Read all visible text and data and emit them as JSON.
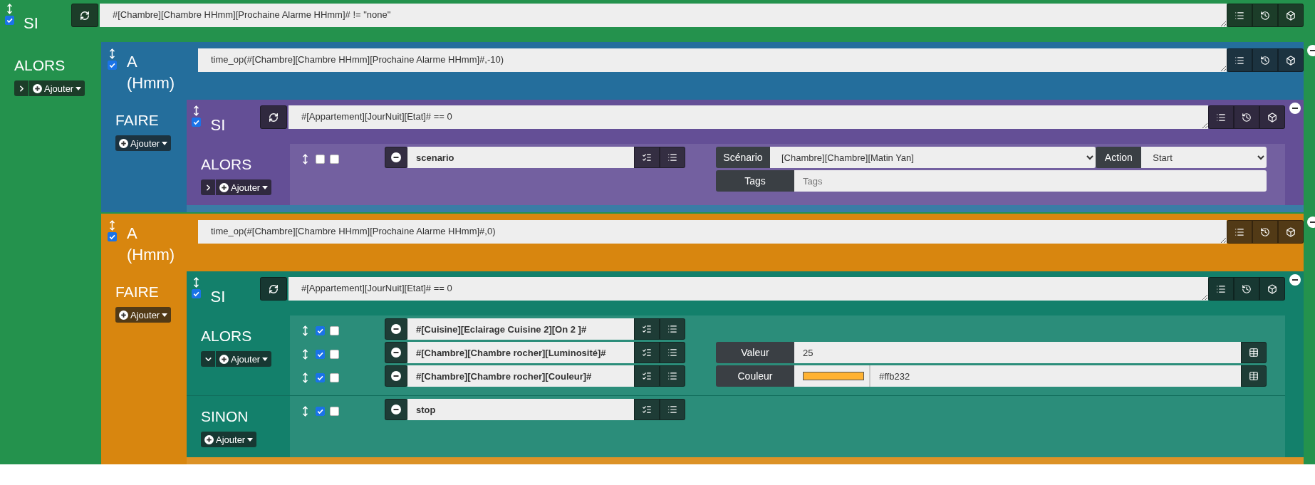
{
  "root": {
    "kind": "si",
    "color": "#24924d",
    "enabled": true,
    "label": "SI",
    "expression": "#[Chambre][Chambre HHmm][Prochaine Alarme HHmm]# != \"none\"",
    "sections": [
      {
        "label": "ALORS",
        "expanded": false,
        "add_label": "Ajouter",
        "blocks": [
          {
            "kind": "a",
            "color": "#246e9c",
            "enabled": true,
            "label": "A (Hmm)",
            "expression": "time_op(#[Chambre][Chambre HHmm][Prochaine Alarme HHmm]#,-10)",
            "sections": [
              {
                "label": "FAIRE",
                "add_label": "Ajouter",
                "blocks": [
                  {
                    "kind": "si",
                    "color": "#644f96",
                    "enabled": true,
                    "label": "SI",
                    "expression": "#[Appartement][JourNuit][Etat]# == 0",
                    "sections": [
                      {
                        "label": "ALORS",
                        "expanded": false,
                        "add_label": "Ajouter",
                        "actions": [
                          {
                            "enabled": false,
                            "parallel": false,
                            "command": "scenario",
                            "option_rows": [
                              [
                                {
                                  "kind": "select",
                                  "label": "Scénario",
                                  "value": "[Chambre][Chambre][Matin Yan]"
                                },
                                {
                                  "kind": "select",
                                  "label": "Action",
                                  "value": "Start"
                                }
                              ],
                              [
                                {
                                  "kind": "text",
                                  "label": "Tags",
                                  "placeholder": "Tags"
                                }
                              ]
                            ]
                          }
                        ]
                      }
                    ]
                  }
                ]
              }
            ]
          },
          {
            "kind": "a",
            "color": "#d8860f",
            "enabled": true,
            "label": "A (Hmm)",
            "expression": "time_op(#[Chambre][Chambre HHmm][Prochaine Alarme HHmm]#,0)",
            "sections": [
              {
                "label": "FAIRE",
                "add_label": "Ajouter",
                "blocks": [
                  {
                    "kind": "si",
                    "color": "#13806b",
                    "enabled": true,
                    "label": "SI",
                    "expression": "#[Appartement][JourNuit][Etat]# == 0",
                    "sections": [
                      {
                        "label": "ALORS",
                        "expanded": true,
                        "add_label": "Ajouter",
                        "actions": [
                          {
                            "enabled": true,
                            "parallel": false,
                            "command": "#[Cuisine][Eclairage Cuisine 2][On 2 ]#"
                          },
                          {
                            "enabled": true,
                            "parallel": false,
                            "command": "#[Chambre][Chambre rocher][Luminosité]#",
                            "option_rows": [
                              [
                                {
                                  "kind": "value",
                                  "label": "Valeur",
                                  "value": "25"
                                }
                              ]
                            ]
                          },
                          {
                            "enabled": true,
                            "parallel": false,
                            "command": "#[Chambre][Chambre rocher][Couleur]#",
                            "option_rows": [
                              [
                                {
                                  "kind": "color",
                                  "label": "Couleur",
                                  "color": "#ffb232",
                                  "value": "#ffb232"
                                }
                              ]
                            ]
                          }
                        ]
                      },
                      {
                        "label": "SINON",
                        "add_label": "Ajouter",
                        "actions": [
                          {
                            "enabled": true,
                            "parallel": false,
                            "command": "stop"
                          }
                        ]
                      }
                    ]
                  }
                ]
              }
            ]
          }
        ]
      }
    ]
  }
}
